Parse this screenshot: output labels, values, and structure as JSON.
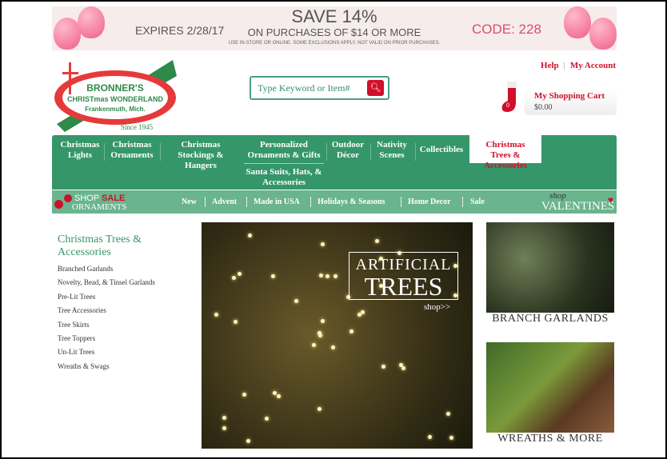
{
  "banner": {
    "expires": "EXPIRES 2/28/17",
    "headline": "SAVE 14%",
    "subline": "ON PURCHASES OF $14 OR MORE",
    "fine_print": "USE IN-STORE OR ONLINE. SOME EXCLUSIONS APPLY. NOT VALID ON PRIOR PURCHASES.",
    "code": "CODE: 228"
  },
  "logo": {
    "line1": "BRONNER'S",
    "line2": "CHRISTmas WONDERLAND",
    "line3": "Frankenmuth, Mich.",
    "since": "Since 1945"
  },
  "search": {
    "placeholder": "Type Keyword or Item#"
  },
  "top_links": {
    "help": "Help",
    "account": "My Account"
  },
  "cart": {
    "title": "My Shopping Cart",
    "total": "$0.00",
    "count": "0"
  },
  "nav": {
    "items": [
      "Christmas Lights",
      "Christmas Ornaments",
      "Christmas Stockings & Hangers",
      "Personalized Ornaments & Gifts",
      "Outdoor Décor",
      "Nativity Scenes",
      "Collectibles",
      "Christmas Trees & Accessories",
      "Santa Suits, Hats, & Accessories"
    ],
    "active": "Christmas Trees & Accessories"
  },
  "subnav": {
    "promo_left": {
      "shop": "SHOP",
      "sale": "SALE",
      "ornaments": "ORNAMENTS"
    },
    "items": [
      "New",
      "Advent",
      "Made in USA",
      "Holidays & Seasons",
      "Home Decor",
      "Sale"
    ],
    "promo_right": {
      "shop": "shop",
      "valentines": "VALENTINES"
    }
  },
  "sidebar": {
    "title": "Christmas Trees & Accessories",
    "items": [
      "Branched Garlands",
      "Novelty, Bead, & Tinsel Garlands",
      "Pre-Lit Trees",
      "Tree Accessories",
      "Tree Skirts",
      "Tree Toppers",
      "Un-Lit Trees",
      "Wreaths & Swags"
    ]
  },
  "hero": {
    "line1": "ARTIFICIAL",
    "line2": "TREES",
    "link": "shop>>"
  },
  "tiles": [
    {
      "caption": "BRANCH GARLANDS"
    },
    {
      "caption": "WREATHS & MORE"
    }
  ],
  "colors": {
    "green": "#35966a",
    "subnav": "#6ab48e",
    "red": "#d0102a"
  }
}
